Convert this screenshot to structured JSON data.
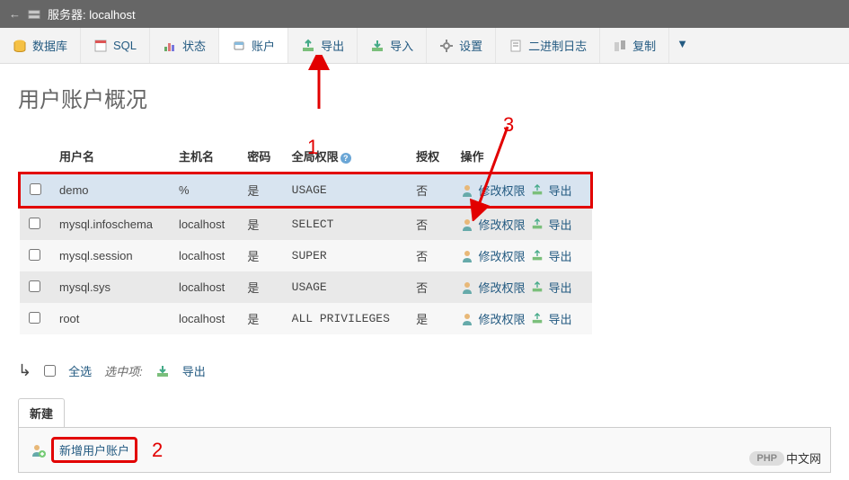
{
  "breadcrumb": {
    "prefix": "服务器:",
    "server": "localhost"
  },
  "tabs": [
    {
      "label": "数据库"
    },
    {
      "label": "SQL"
    },
    {
      "label": "状态"
    },
    {
      "label": "账户",
      "active": true
    },
    {
      "label": "导出"
    },
    {
      "label": "导入"
    },
    {
      "label": "设置"
    },
    {
      "label": "二进制日志"
    },
    {
      "label": "复制"
    }
  ],
  "page": {
    "title": "用户账户概况"
  },
  "table": {
    "headers": {
      "user": "用户名",
      "host": "主机名",
      "pwd": "密码",
      "priv": "全局权限",
      "grant": "授权",
      "ops": "操作"
    },
    "ops": {
      "edit": "修改权限",
      "export": "导出"
    },
    "rows": [
      {
        "user": "demo",
        "host": "%",
        "pwd": "是",
        "priv": "USAGE",
        "grant": "否",
        "highlight": true
      },
      {
        "user": "mysql.infoschema",
        "host": "localhost",
        "pwd": "是",
        "priv": "SELECT",
        "grant": "否"
      },
      {
        "user": "mysql.session",
        "host": "localhost",
        "pwd": "是",
        "priv": "SUPER",
        "grant": "否"
      },
      {
        "user": "mysql.sys",
        "host": "localhost",
        "pwd": "是",
        "priv": "USAGE",
        "grant": "否"
      },
      {
        "user": "root",
        "host": "localhost",
        "pwd": "是",
        "priv": "ALL PRIVILEGES",
        "grant": "是"
      }
    ]
  },
  "footer": {
    "checkall": "全选",
    "withselected": "选中项:",
    "export": "导出"
  },
  "newsec": {
    "title": "新建",
    "link": "新增用户账户"
  },
  "annotations": {
    "a1": "1",
    "a2": "2",
    "a3": "3"
  },
  "watermark": {
    "badge": "PHP",
    "text": "中文网"
  }
}
